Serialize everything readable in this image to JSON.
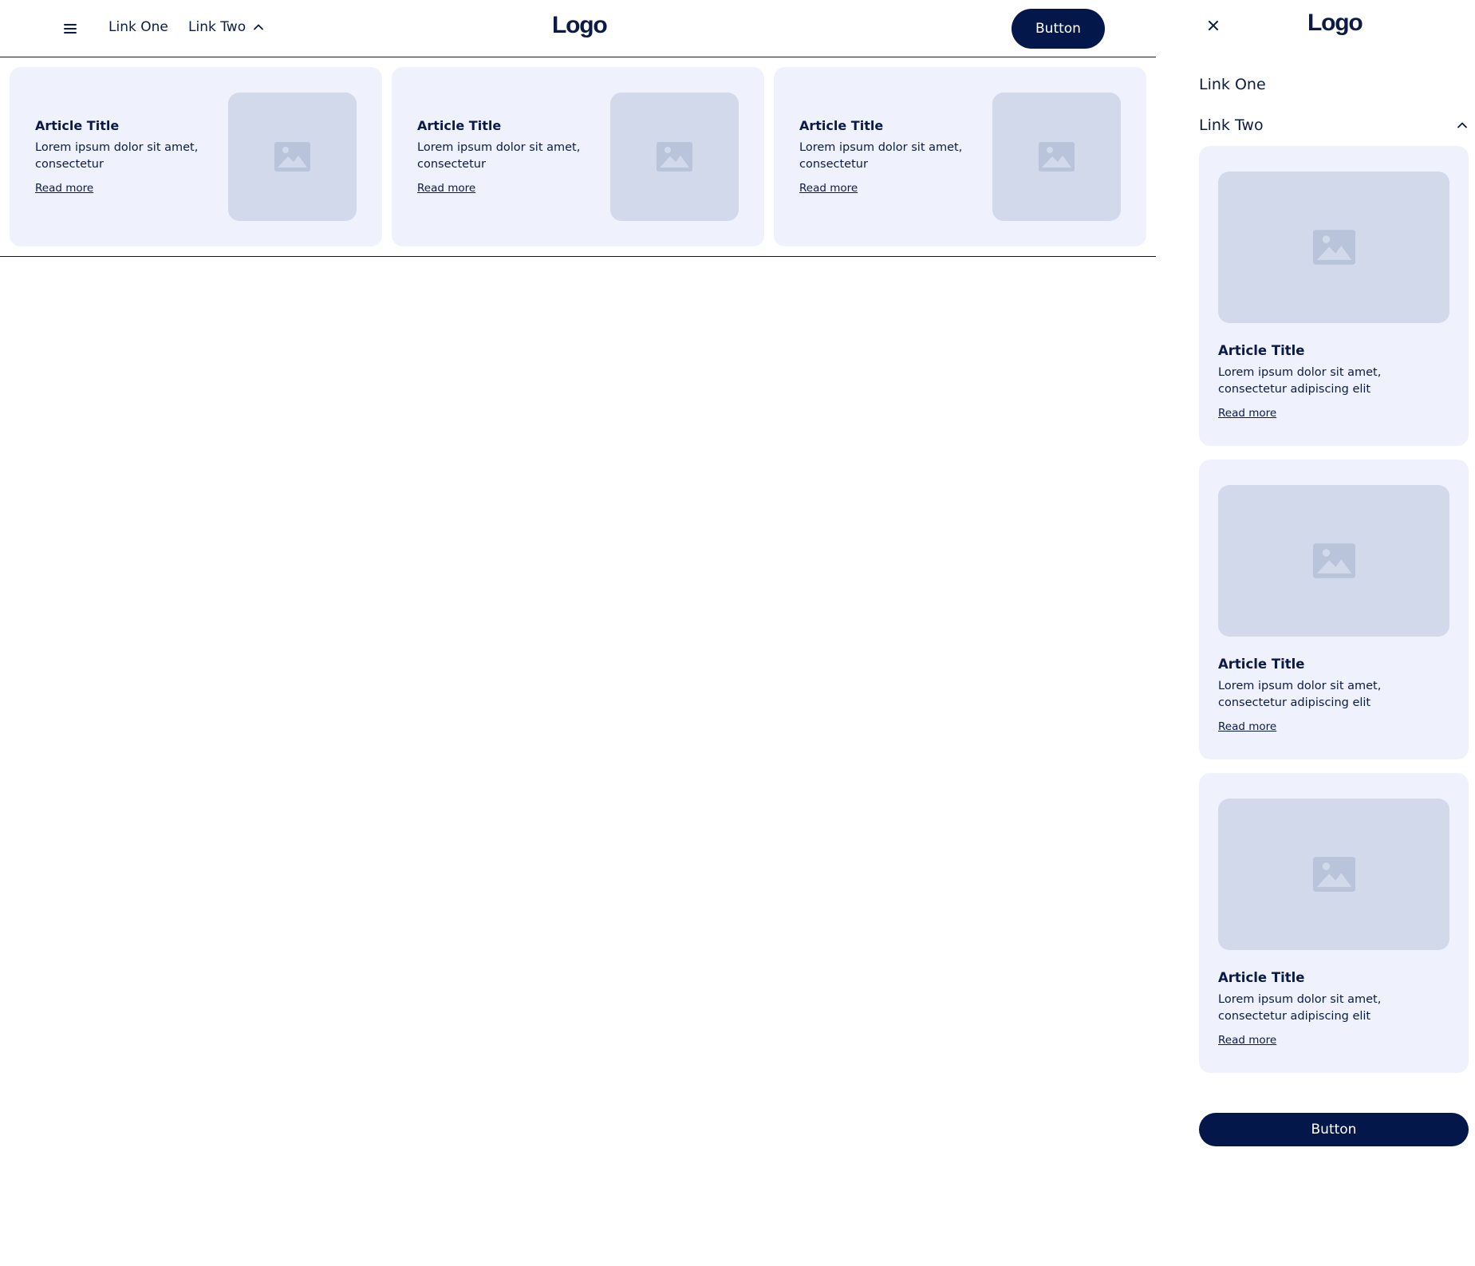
{
  "colors": {
    "primary": "#04174a",
    "text": "#0b1b45",
    "card_bg": "#eff2fc",
    "image_placeholder": "#d1d9eb",
    "image_icon": "#b9c3da"
  },
  "navbar": {
    "menu_icon": "hamburger-icon",
    "links": [
      {
        "label": "Link One"
      },
      {
        "label": "Link Two",
        "icon": "chevron-up-icon",
        "expanded": true
      }
    ],
    "logo": "Logo",
    "button": "Button"
  },
  "dropdown": {
    "cards": [
      {
        "title": "Article Title",
        "description": "Lorem ipsum dolor sit amet, consectetur",
        "link": "Read more",
        "image_icon": "image-icon"
      },
      {
        "title": "Article Title",
        "description": "Lorem ipsum dolor sit amet, consectetur",
        "link": "Read more",
        "image_icon": "image-icon"
      },
      {
        "title": "Article Title",
        "description": "Lorem ipsum dolor sit amet, consectetur",
        "link": "Read more",
        "image_icon": "image-icon"
      }
    ]
  },
  "mobile": {
    "close_icon": "close-icon",
    "logo": "Logo",
    "links": [
      {
        "label": "Link One"
      },
      {
        "label": "Link Two",
        "icon": "chevron-up-icon",
        "expanded": true
      }
    ],
    "cards": [
      {
        "title": "Article Title",
        "description": "Lorem ipsum dolor sit amet, consectetur adipiscing elit",
        "link": "Read more",
        "image_icon": "image-icon"
      },
      {
        "title": "Article Title",
        "description": "Lorem ipsum dolor sit amet, consectetur adipiscing elit",
        "link": "Read more",
        "image_icon": "image-icon"
      },
      {
        "title": "Article Title",
        "description": "Lorem ipsum dolor sit amet, consectetur adipiscing elit",
        "link": "Read more",
        "image_icon": "image-icon"
      }
    ],
    "button": "Button"
  }
}
